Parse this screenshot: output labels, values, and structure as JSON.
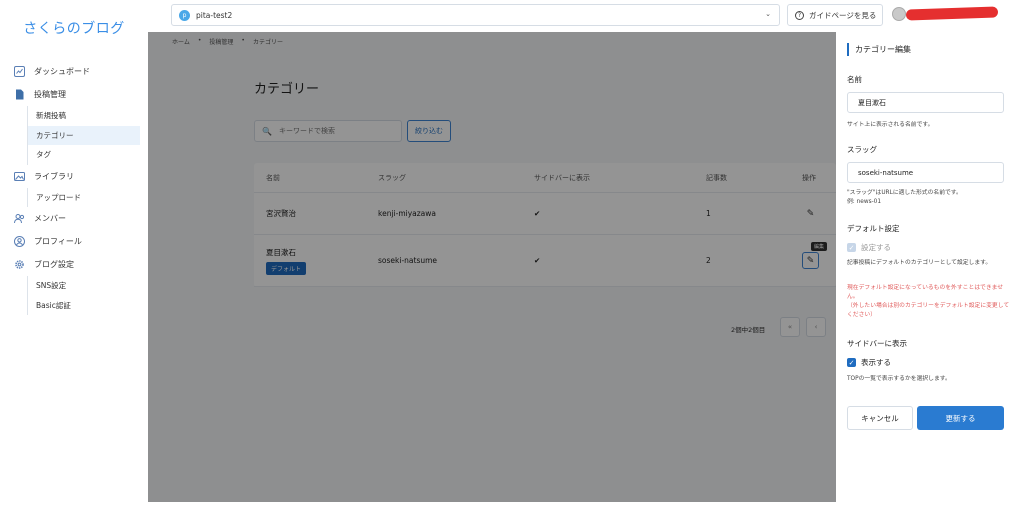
{
  "app": {
    "logo": "さくらのブログ"
  },
  "topbar": {
    "site_initial": "p",
    "site_name": "pita-test2",
    "guide_label": "ガイドページを見る"
  },
  "sidebar": {
    "items": [
      {
        "label": "ダッシュボード",
        "icon": "chart-icon"
      },
      {
        "label": "投稿管理",
        "icon": "document-icon"
      },
      {
        "label": "ライブラリ",
        "icon": "image-icon"
      },
      {
        "label": "メンバー",
        "icon": "users-icon"
      },
      {
        "label": "プロフィール",
        "icon": "user-circle-icon"
      },
      {
        "label": "ブログ設定",
        "icon": "gear-icon"
      }
    ],
    "post_sub": [
      "新規投稿",
      "カテゴリー",
      "タグ"
    ],
    "library_sub": [
      "アップロード"
    ],
    "settings_sub": [
      "SNS設定",
      "Basic認証"
    ]
  },
  "breadcrumb": [
    "ホーム",
    "投稿管理",
    "カテゴリー"
  ],
  "main": {
    "title": "カテゴリー",
    "search_placeholder": "キーワードで検索",
    "filter_label": "絞り込む",
    "columns": [
      "名前",
      "スラッグ",
      "サイドバーに表示",
      "記事数",
      "操作"
    ],
    "rows": [
      {
        "name": "宮沢賢治",
        "slug": "kenji-miyazawa",
        "sidebar": "✔",
        "count": "1"
      },
      {
        "name": "夏目漱石",
        "badge": "デフォルト",
        "slug": "soseki-natsume",
        "sidebar": "✔",
        "count": "2"
      }
    ],
    "tooltip": "編集",
    "pager_info": "2個中2個目",
    "pager_prev": "«",
    "pager_next": "‹"
  },
  "panel": {
    "title": "カテゴリー編集",
    "name_label": "名前",
    "name_value": "夏目漱石",
    "name_help": "サイト上に表示される名前です。",
    "slug_label": "スラッグ",
    "slug_value": "soseki-natsume",
    "slug_help1": "\"スラッグ\"はURLに適した形式の名前です。",
    "slug_help2": "例: news-01",
    "default_label": "デフォルト設定",
    "default_checkbox": "設定する",
    "default_help": "記事投稿にデフォルトのカテゴリーとして設定します。",
    "default_warn1": "現在デフォルト設定になっているものを外すことはできません。",
    "default_warn2": "（外したい場合は別のカテゴリーをデフォルト設定に変更してください）",
    "sidebar_label": "サイドバーに表示",
    "sidebar_checkbox": "表示する",
    "sidebar_help": "TOPの一覧で表示するかを選択します。",
    "cancel_label": "キャンセル",
    "update_label": "更新する"
  },
  "colors": {
    "accent": "#1f6cc0",
    "warn": "#e05a5a",
    "logo": "#3a8ee6"
  }
}
